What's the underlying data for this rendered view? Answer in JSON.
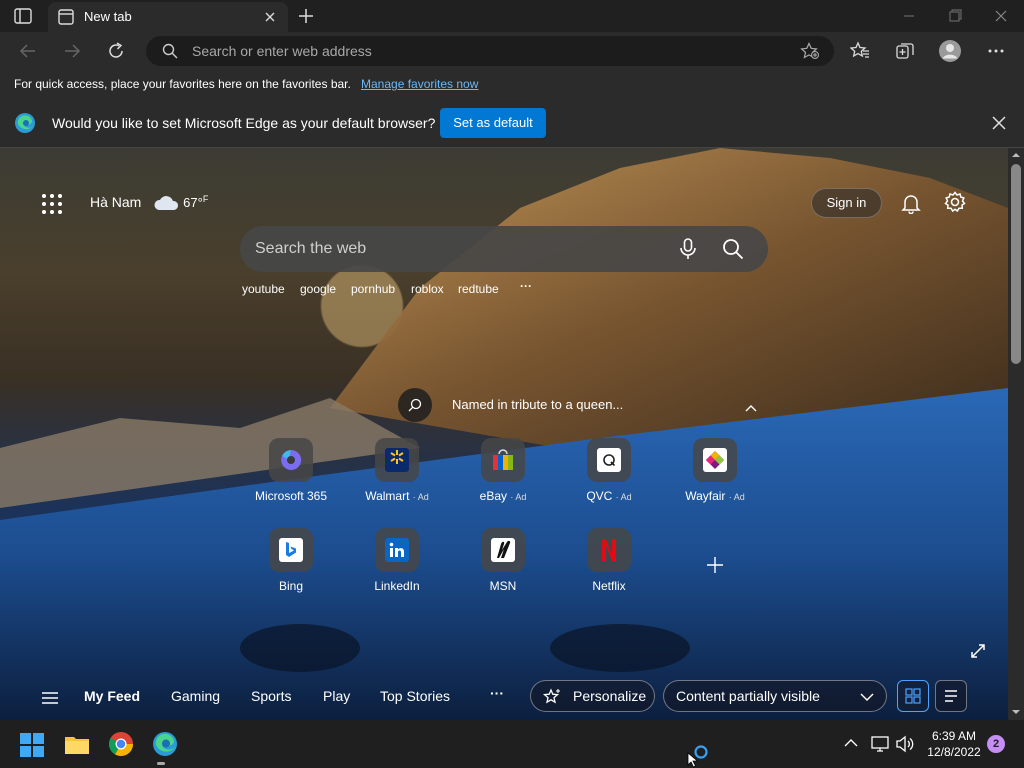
{
  "browser": {
    "tab_title": "New tab",
    "address_placeholder": "Search or enter web address"
  },
  "favorites_bar": {
    "text": "For quick access, place your favorites here on the favorites bar.",
    "link": "Manage favorites now"
  },
  "infobar": {
    "text": "Would you like to set Microsoft Edge as your default browser?",
    "button": "Set as default"
  },
  "newtab": {
    "weather": {
      "location": "Hà Nam",
      "temp": "67°",
      "unit": "F"
    },
    "signin": "Sign in",
    "search_placeholder": "Search the web",
    "suggestions": [
      "youtube",
      "google",
      "pornhub",
      "roblox",
      "redtube"
    ],
    "suggestions_more": "···",
    "image_caption": "Named in tribute to a queen...",
    "tiles": [
      {
        "label": "Microsoft 365",
        "ad": ""
      },
      {
        "label": "Walmart",
        "ad": "· Ad"
      },
      {
        "label": "eBay",
        "ad": "· Ad"
      },
      {
        "label": "QVC",
        "ad": "· Ad"
      },
      {
        "label": "Wayfair",
        "ad": "· Ad"
      },
      {
        "label": "Bing",
        "ad": ""
      },
      {
        "label": "LinkedIn",
        "ad": ""
      },
      {
        "label": "MSN",
        "ad": ""
      },
      {
        "label": "Netflix",
        "ad": ""
      }
    ],
    "feed_tabs": [
      "My Feed",
      "Gaming",
      "Sports",
      "Play",
      "Top Stories"
    ],
    "feed_more": "···",
    "personalize": "Personalize",
    "content_visibility": "Content partially visible"
  },
  "taskbar": {
    "time": "6:39 AM",
    "date": "12/8/2022",
    "notifications": "2"
  },
  "colors": {
    "accent": "#0078d4",
    "link": "#6cb8f6",
    "badge": "#c58ef5"
  }
}
